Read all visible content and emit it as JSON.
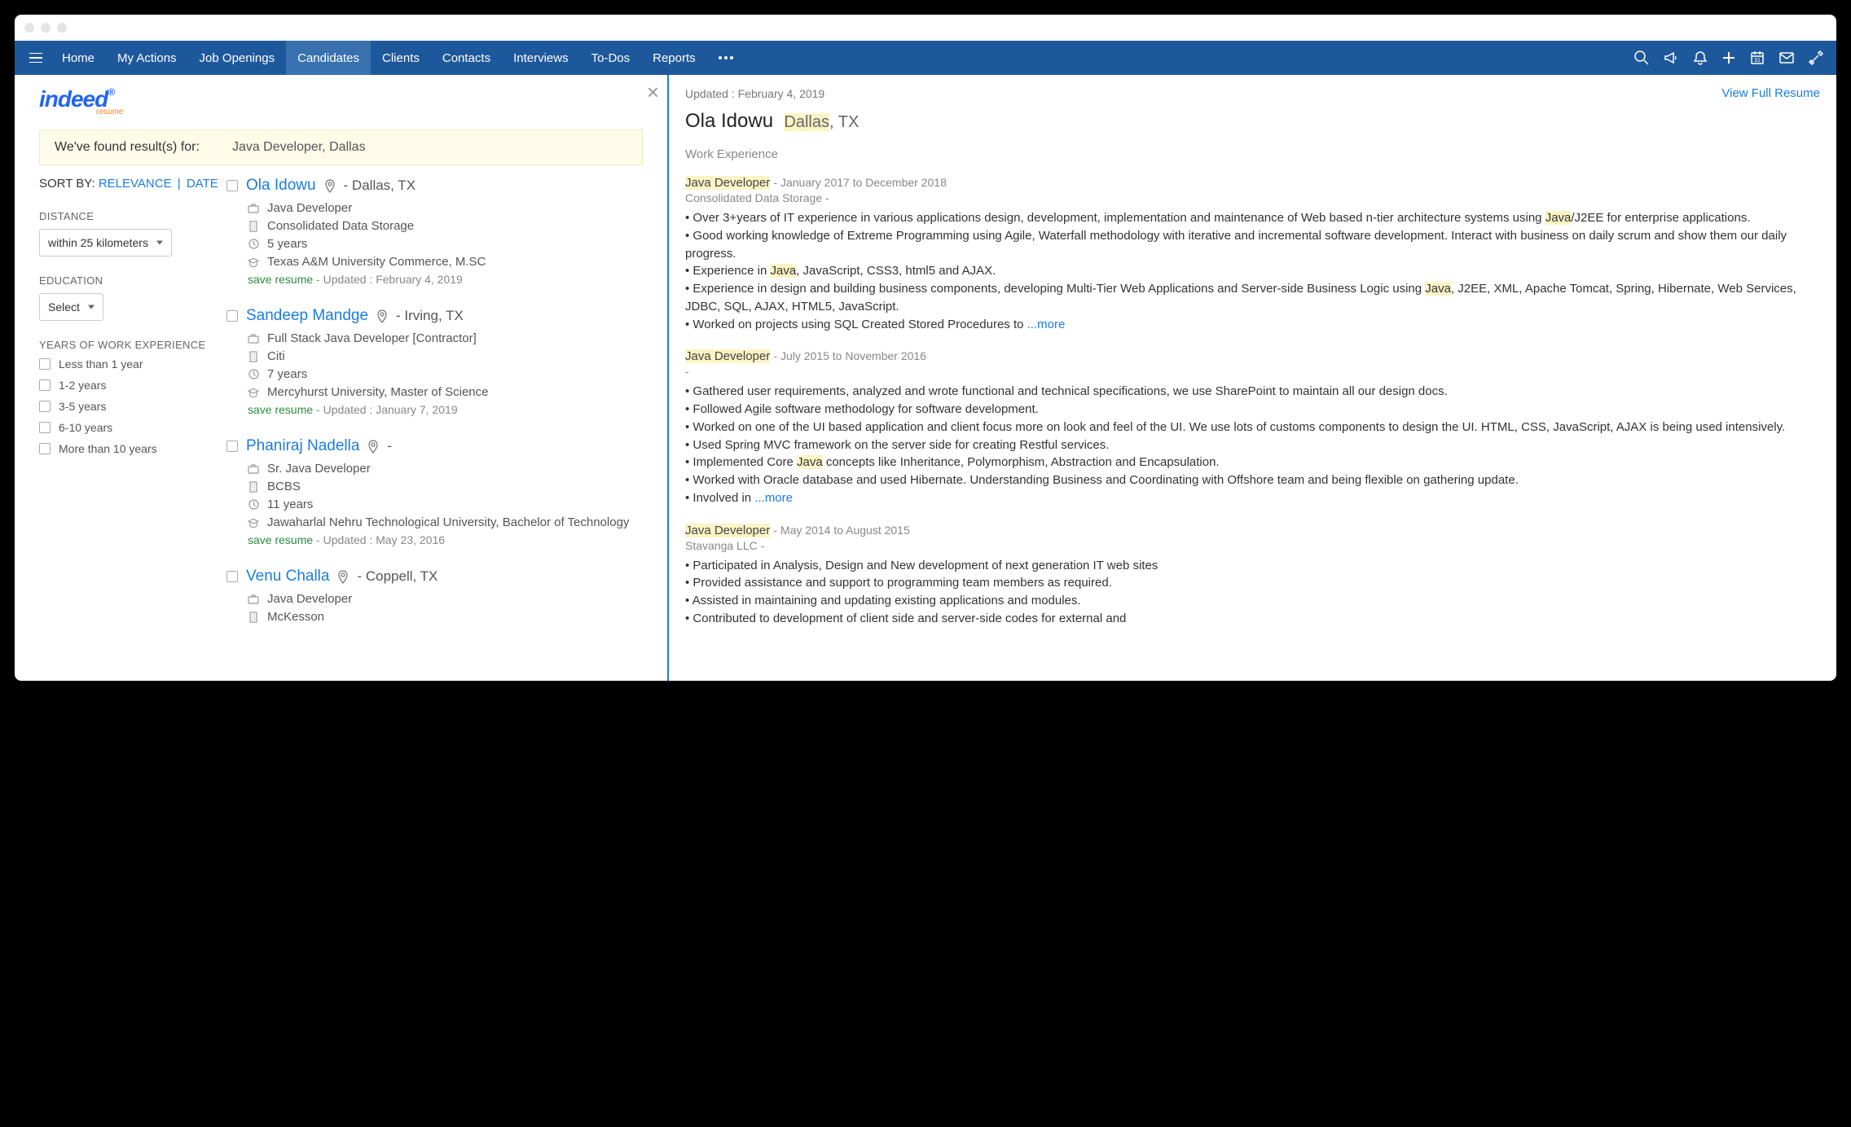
{
  "nav": {
    "items": [
      "Home",
      "My Actions",
      "Job Openings",
      "Candidates",
      "Clients",
      "Contacts",
      "Interviews",
      "To-Dos",
      "Reports"
    ],
    "active": 3
  },
  "resultsBar": {
    "label": "We've found result(s) for:",
    "query": "Java Developer, Dallas"
  },
  "sort": {
    "label": "SORT BY:",
    "relevance": "RELEVANCE",
    "date": "DATE"
  },
  "filters": {
    "distanceLabel": "DISTANCE",
    "distanceValue": "within 25 kilometers",
    "educationLabel": "EDUCATION",
    "educationValue": "Select",
    "yearsLabel": "YEARS OF WORK EXPERIENCE",
    "yearsOptions": [
      "Less than 1 year",
      "1-2 years",
      "3-5 years",
      "6-10 years",
      "More than 10 years"
    ]
  },
  "candidates": [
    {
      "name": "Ola Idowu",
      "location": "- Dallas, TX",
      "title": "Java Developer",
      "company": "Consolidated Data Storage",
      "years": "5 years",
      "education": "Texas A&M University Commerce, M.SC",
      "save": "save resume",
      "updated": "- Updated : February 4, 2019"
    },
    {
      "name": "Sandeep Mandge",
      "location": "- Irving, TX",
      "title": "Full Stack Java Developer [Contractor]",
      "company": "Citi",
      "years": "7 years",
      "education": "Mercyhurst University, Master of Science",
      "save": "save resume",
      "updated": "- Updated : January 7, 2019"
    },
    {
      "name": "Phaniraj Nadella",
      "location": "-",
      "title": "Sr. Java Developer",
      "company": "BCBS",
      "years": "11 years",
      "education": "Jawaharlal Nehru Technological University, Bachelor of Technology",
      "save": "save resume",
      "updated": "- Updated : May 23, 2016"
    },
    {
      "name": "Venu Challa",
      "location": "- Coppell, TX",
      "title": "Java Developer",
      "company": "McKesson",
      "years": "",
      "education": "",
      "save": "",
      "updated": ""
    }
  ],
  "detail": {
    "updated": "Updated : February 4, 2019",
    "viewFull": "View Full Resume",
    "name": "Ola Idowu",
    "locHL": "Dallas",
    "locRest": ", TX",
    "sectionTitle": "Work Experience",
    "jobs": [
      {
        "title": "Java Developer",
        "dates": "- January 2017 to December 2018",
        "company": "Consolidated Data Storage -",
        "bullets": [
          "• Over 3+years of IT experience in various applications design, development, implementation and maintenance of Web based n-tier architecture systems using <hl>Java</hl>/J2EE for enterprise applications.",
          "• Good working knowledge of Extreme Programming using Agile, Waterfall methodology with iterative and incremental software development. Interact with business on daily scrum and show them our daily progress.",
          "• Experience in <hl>Java</hl>, JavaScript, CSS3, html5 and AJAX.",
          "• Experience in design and building business components, developing Multi-Tier Web Applications and Server-side Business Logic using <hl>Java</hl>, J2EE, XML, Apache Tomcat, Spring, Hibernate, Web Services, JDBC, SQL, AJAX, HTML5, JavaScript.",
          "• Worked on projects using SQL Created Stored Procedures to <more>...more</more>"
        ]
      },
      {
        "title": "Java Developer",
        "dates": "- July 2015 to November 2016",
        "company": "-",
        "bullets": [
          "• Gathered user requirements, analyzed and wrote functional and technical specifications, we use SharePoint to maintain all our design docs.",
          "• Followed Agile software methodology for software development.",
          "• Worked on one of the UI based application and client focus more on look and feel of the UI. We use lots of customs components to design the UI. HTML, CSS, JavaScript, AJAX is being used intensively.",
          "• Used Spring MVC framework on the server side for creating Restful services.",
          "• Implemented Core <hl>Java</hl> concepts like Inheritance, Polymorphism, Abstraction and Encapsulation.",
          "• Worked with Oracle database and used Hibernate. Understanding Business and Coordinating with Offshore team and being flexible on gathering update.",
          "• Involved in <more>...more</more>"
        ]
      },
      {
        "title": "Java Developer",
        "dates": "- May 2014 to August 2015",
        "company": "Stavanga LLC -",
        "bullets": [
          "• Participated in Analysis, Design and New development of next generation IT web sites",
          "• Provided assistance and support to programming team members as required.",
          "• Assisted in maintaining and updating existing applications and modules.",
          "• Contributed to development of client side and server-side codes for external and"
        ]
      }
    ]
  }
}
